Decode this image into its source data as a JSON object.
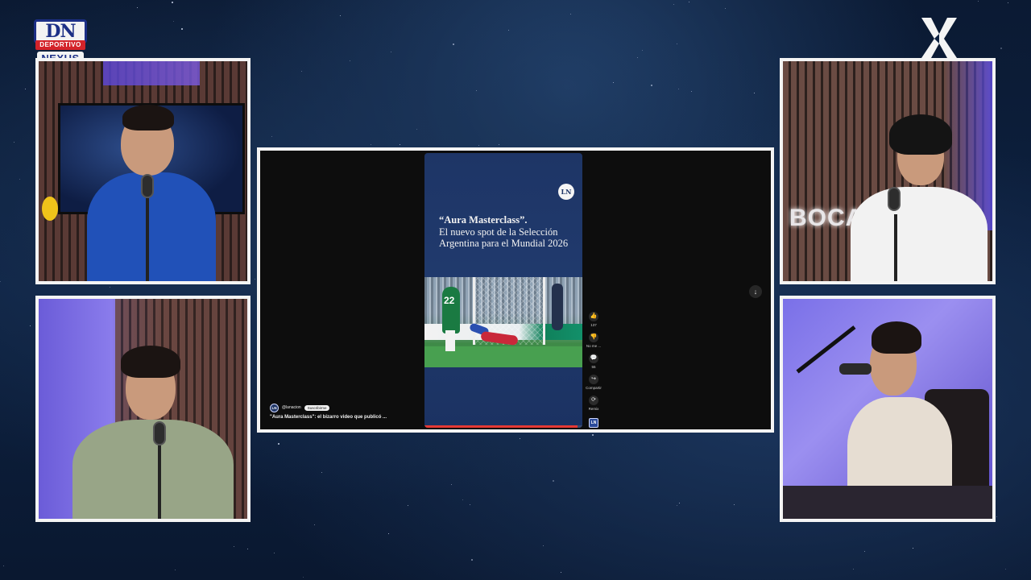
{
  "branding": {
    "logo_left": {
      "main": "DN",
      "sub": "DEPORTIVO",
      "name": "NEXUS"
    },
    "logo_right": "X"
  },
  "cams": [
    {
      "id": "host-top-left",
      "shirt_color": "#1f4bb0"
    },
    {
      "id": "host-top-right",
      "shirt_color": "#f2f2f2",
      "wall_text": "BOCA"
    },
    {
      "id": "host-bottom-left",
      "shirt_color": "#9aa88a"
    },
    {
      "id": "host-bottom-right",
      "shirt_color": "#e8e0d8"
    }
  ],
  "short": {
    "badge": "LN",
    "headline_bold": "“Aura Masterclass”.",
    "headline_rest": "El nuevo spot de la Selección Argentina para el Mundial 2026",
    "thumbnail_number": "22",
    "progress_fraction": 0.97,
    "actions": [
      {
        "icon": "like-icon",
        "glyph": "👍",
        "label": "137"
      },
      {
        "icon": "dislike-icon",
        "glyph": "👎",
        "label": "No me ..."
      },
      {
        "icon": "comment-icon",
        "glyph": "💬",
        "label": "55"
      },
      {
        "icon": "share-icon",
        "glyph": "↪",
        "label": "Compartir"
      },
      {
        "icon": "remix-icon",
        "glyph": "⟳",
        "label": "Remix"
      }
    ],
    "channel_avatar": "LN",
    "channel_handle": "@lanacion",
    "subscribe_label": "Suscribirme",
    "title": "\"Aura Masterclass\": el bizarro video que publicó ...",
    "scroll_button": "↓"
  },
  "colors": {
    "background": "#0d2140",
    "frame": "#f4f4f4",
    "short_bg": "#1e3566",
    "progress": "#e53935"
  }
}
